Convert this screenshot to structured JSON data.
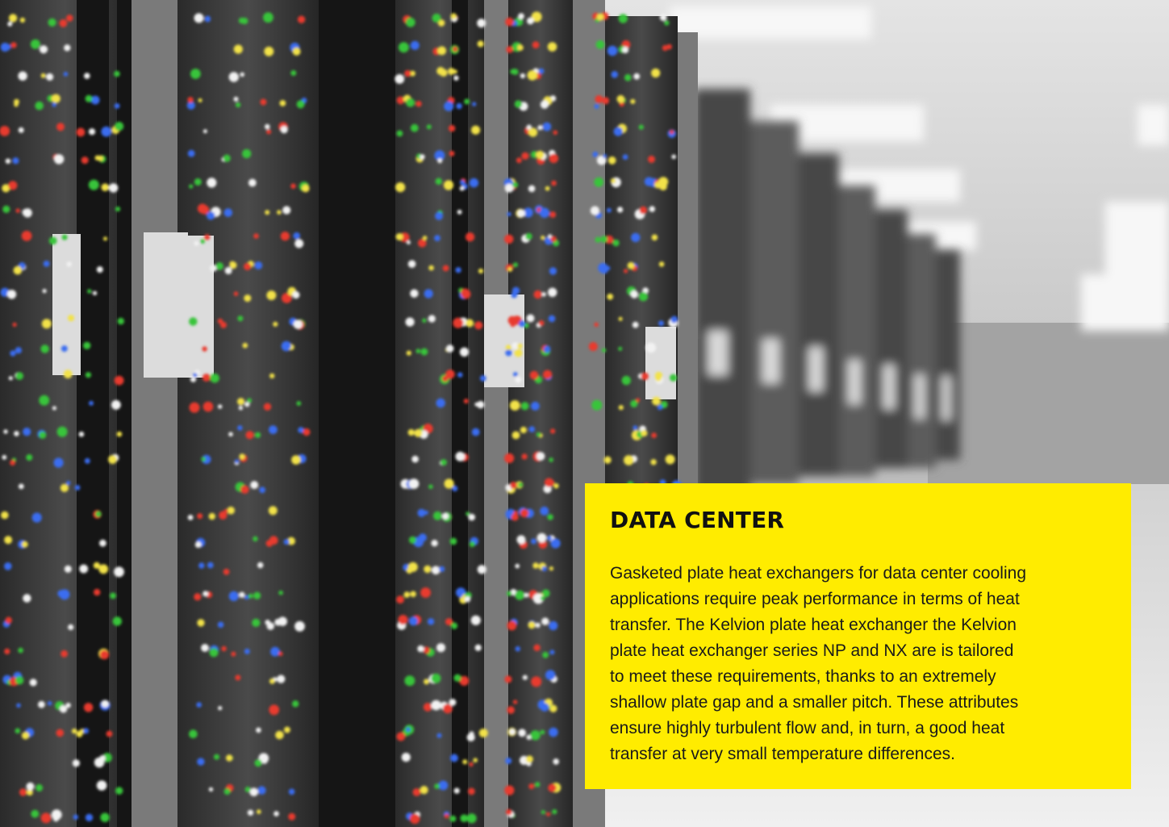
{
  "photo": {
    "subject": "data center server racks",
    "colors": {
      "rack_dark": "#151515",
      "rack_frame": "#7a7a7a",
      "glass": "#3c3c3c",
      "wall": "#a9a9a9",
      "ceiling": "#d8d8d8",
      "floor": "#e6e6e6",
      "light": "#f7f7f7",
      "led": [
        "#e83a2f",
        "#39c43a",
        "#f2e24a",
        "#3a6df0",
        "#f2f2f2"
      ]
    }
  },
  "card": {
    "accent_color": "#ffec00",
    "title": "DATA CENTER",
    "body_lines": [
      "Gasketed plate heat exchangers for data center cooling",
      "applications require peak performance in terms of heat",
      "transfer. The Kelvion plate heat exchanger the Kelvion",
      "plate heat exchanger series NP and NX are is tailored",
      "to meet these requirements, thanks to an extremely",
      "shallow plate gap and a smaller pitch. These attributes",
      "ensure highly turbulent flow and, in turn, a good heat",
      "transfer at very small temperature differences."
    ]
  }
}
